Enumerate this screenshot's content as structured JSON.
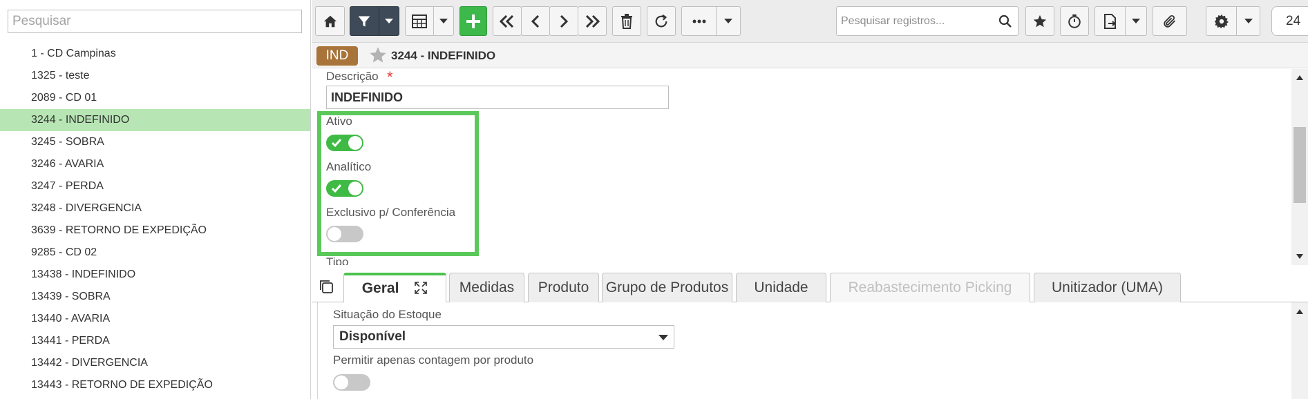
{
  "left_panel": {
    "search_placeholder": "Pesquisar",
    "items": [
      {
        "label": "1 - CD Campinas",
        "selected": false
      },
      {
        "label": "1325 - teste",
        "selected": false
      },
      {
        "label": "2089 - CD 01",
        "selected": false
      },
      {
        "label": "3244 - INDEFINIDO",
        "selected": true
      },
      {
        "label": "3245 - SOBRA",
        "selected": false
      },
      {
        "label": "3246 - AVARIA",
        "selected": false
      },
      {
        "label": "3247 - PERDA",
        "selected": false
      },
      {
        "label": "3248 - DIVERGENCIA",
        "selected": false
      },
      {
        "label": "3639 - RETORNO DE EXPEDIÇÃO",
        "selected": false
      },
      {
        "label": "9285 - CD 02",
        "selected": false
      },
      {
        "label": "13438 - INDEFINIDO",
        "selected": false
      },
      {
        "label": "13439 - SOBRA",
        "selected": false
      },
      {
        "label": "13440 - AVARIA",
        "selected": false
      },
      {
        "label": "13441 - PERDA",
        "selected": false
      },
      {
        "label": "13442 - DIVERGENCIA",
        "selected": false
      },
      {
        "label": "13443 - RETORNO DE EXPEDIÇÃO",
        "selected": false
      }
    ]
  },
  "toolbar": {
    "search_placeholder": "Pesquisar registros...",
    "page_count": "24",
    "icons": [
      "home-icon",
      "filter-icon",
      "table-icon",
      "plus-icon",
      "first-page-icon",
      "previous-icon",
      "next-icon",
      "last-page-icon",
      "trash-icon",
      "refresh-icon",
      "more-icon",
      "search-icon",
      "star-icon",
      "timer-icon",
      "export-icon",
      "paperclip-icon",
      "gear-icon"
    ]
  },
  "record": {
    "badge": "IND",
    "title": "3244 - INDEFINIDO"
  },
  "form": {
    "descricao_label": "Descrição",
    "required_mark": "*",
    "descricao_value": "INDEFINIDO",
    "ativo_label": "Ativo",
    "ativo_on": true,
    "analitico_label": "Analítico",
    "analitico_on": true,
    "exclusivo_label": "Exclusivo p/ Conferência",
    "exclusivo_on": false,
    "tipo_label": "Tipo"
  },
  "tabs": [
    {
      "label": "Geral",
      "active": true,
      "disabled": false
    },
    {
      "label": "Medidas",
      "active": false,
      "disabled": false
    },
    {
      "label": "Produto",
      "active": false,
      "disabled": false
    },
    {
      "label": "Grupo de Produtos",
      "active": false,
      "disabled": false
    },
    {
      "label": "Unidade",
      "active": false,
      "disabled": false
    },
    {
      "label": "Reabastecimento Picking",
      "active": false,
      "disabled": true
    },
    {
      "label": "Unitizador (UMA)",
      "active": false,
      "disabled": false
    }
  ],
  "tab_content": {
    "situacao_label": "Situação do Estoque",
    "situacao_value": "Disponível",
    "permitir_label": "Permitir apenas contagem por produto",
    "permitir_on": false
  },
  "colors": {
    "selected_row": "#b7e6b4",
    "highlight_box": "#5bc85a",
    "toggle_on": "#3fba45",
    "badge": "#a8743a",
    "toolbar_dark": "#3e4a57",
    "toolbar_green": "#3cb94a"
  }
}
